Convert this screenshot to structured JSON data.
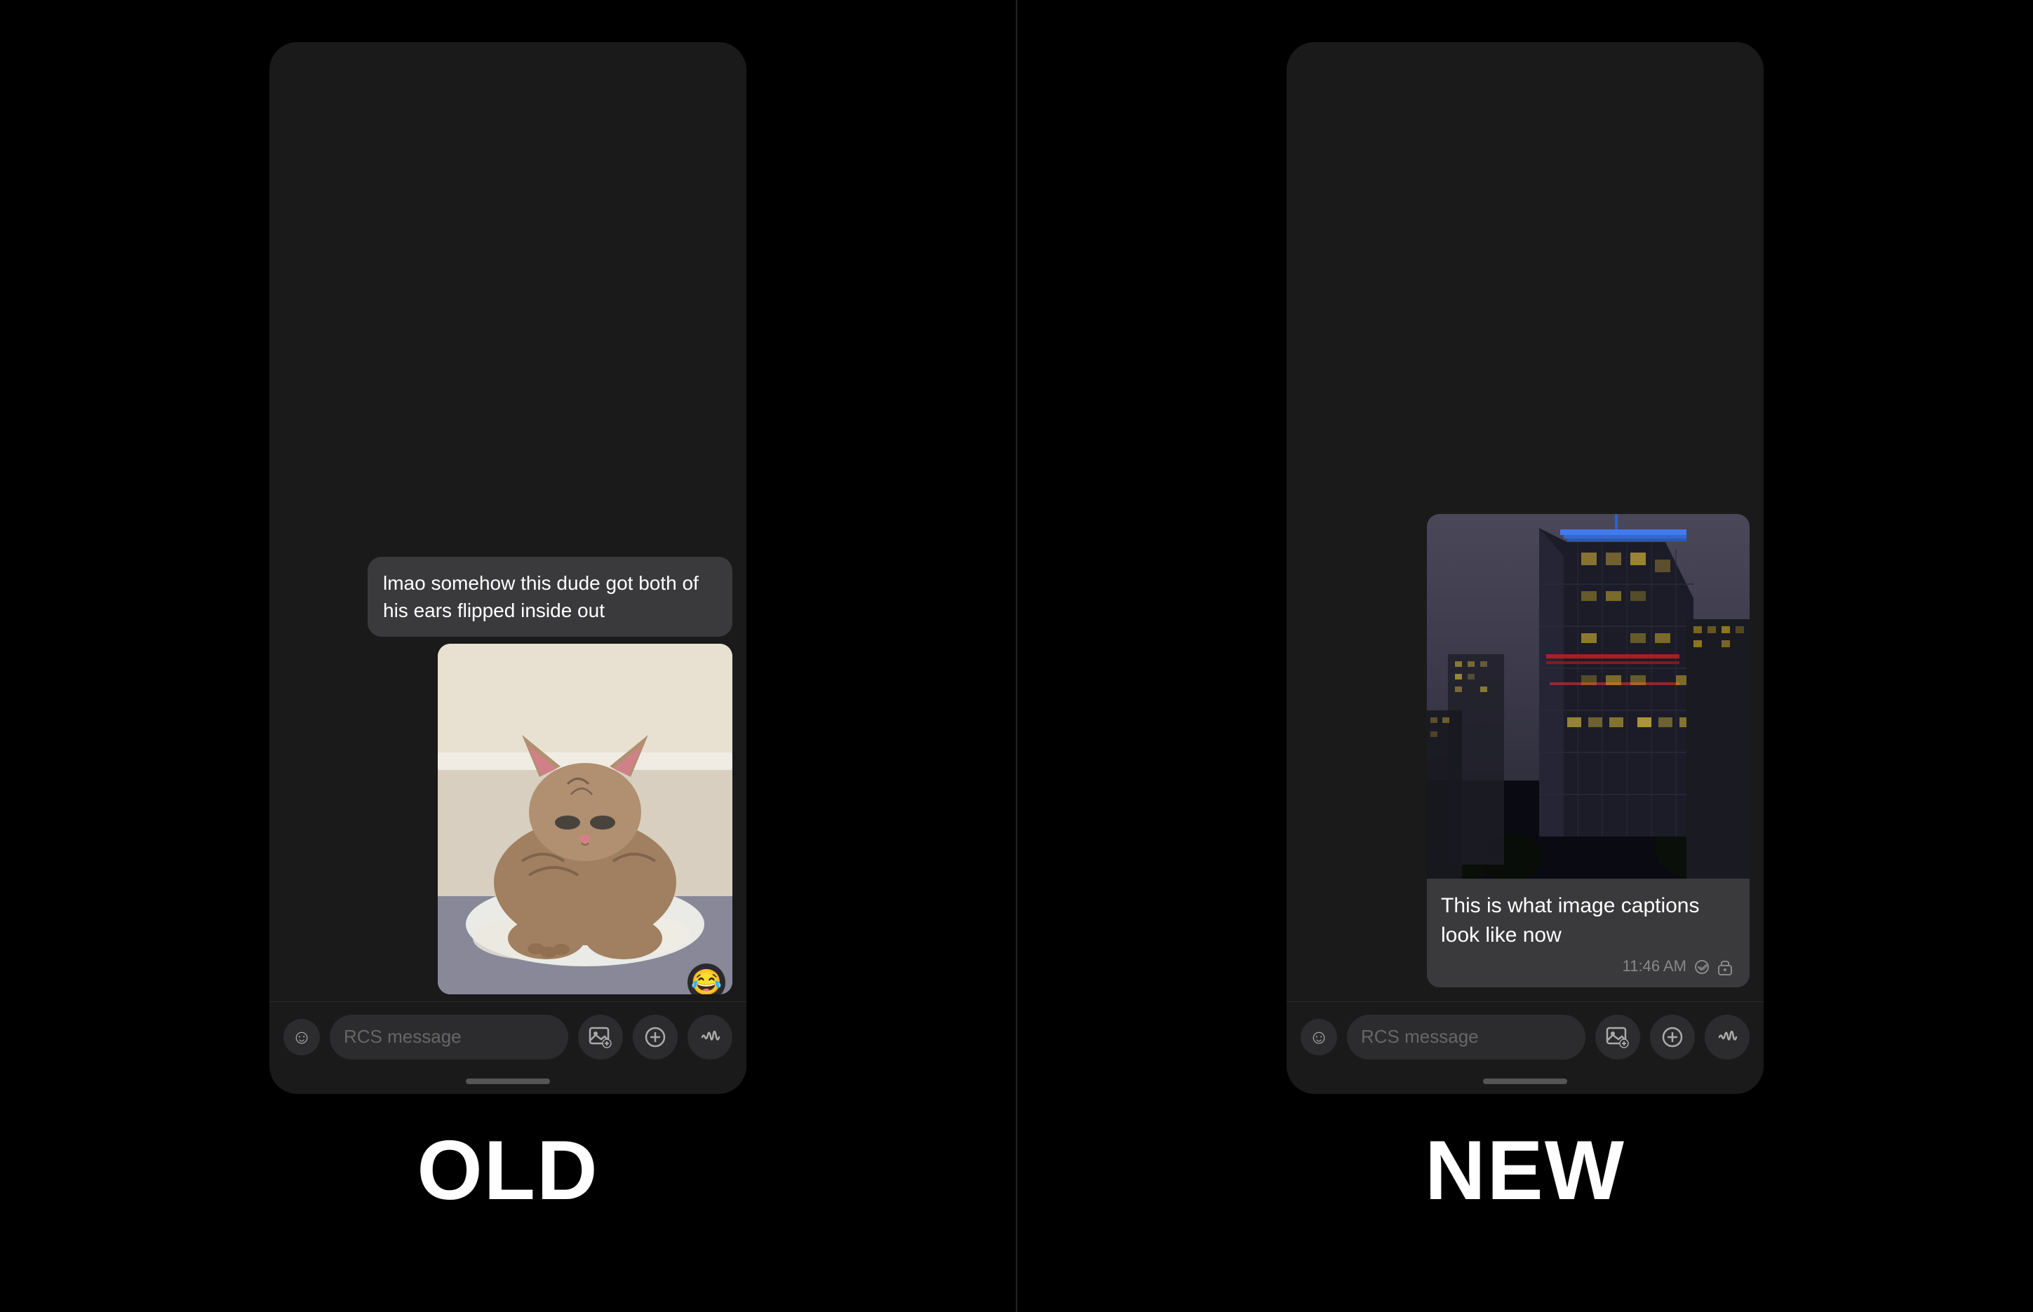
{
  "layout": {
    "background": "#000000"
  },
  "left_panel": {
    "label": "OLD",
    "message_text": "lmao somehow this dude got both of his ears flipped inside out",
    "emoji_reaction": "😂",
    "input_placeholder": "RCS message"
  },
  "right_panel": {
    "label": "NEW",
    "caption_text": "This is what image captions look like now",
    "timestamp": "11:46 AM",
    "input_placeholder": "RCS message"
  },
  "icons": {
    "emoji": "☺",
    "image_attachment": "🖼",
    "add": "+",
    "voice": "🎙",
    "check_delivered": "✓✓",
    "lock": "🔒"
  }
}
